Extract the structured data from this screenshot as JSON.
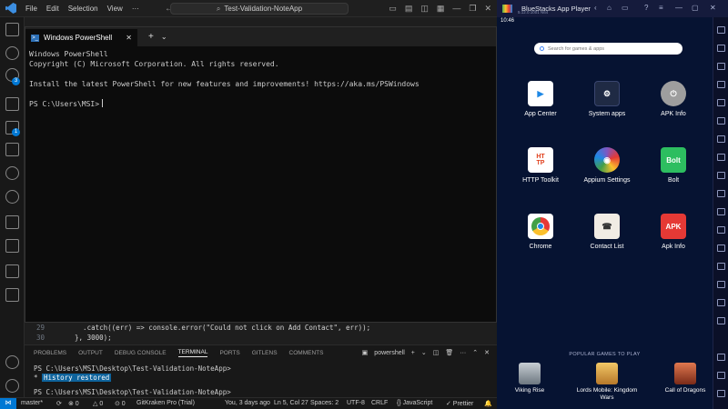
{
  "vscode": {
    "menu": [
      "File",
      "Edit",
      "Selection",
      "View"
    ],
    "more": "···",
    "command_center": "Test-Validation-NoteApp",
    "activity_badges": [
      "3",
      "1"
    ],
    "code": [
      {
        "ln": "29",
        "text": "    .catch((err) => console.error(\"Could not click on Add Contact\", err));"
      },
      {
        "ln": "30",
        "text": "  }, 3000);"
      }
    ],
    "panel": {
      "tabs": [
        "PROBLEMS",
        "OUTPUT",
        "DEBUG CONSOLE",
        "TERMINAL",
        "PORTS",
        "GITLENS",
        "COMMENTS"
      ],
      "active_tab": "TERMINAL",
      "terminal_name": "powershell",
      "lines": [
        "PS C:\\Users\\MSI\\Desktop\\Test-Validation-NoteApp>",
        "History restored",
        "PS C:\\Users\\MSI\\Desktop\\Test-Validation-NoteApp>"
      ]
    },
    "statusbar": {
      "remote": "⋈",
      "branch": "master*",
      "sync": "⟳",
      "errors": "⊗ 0",
      "warnings": "△ 0",
      "ports": "⊙ 0",
      "gitkraken": "GitKraken Pro (Trial)",
      "blame": "You, 3 days ago",
      "position": "Ln 5, Col 27",
      "spaces": "Spaces: 2",
      "encoding": "UTF-8",
      "eol": "CRLF",
      "language": "{} JavaScript",
      "prettier": "✓ Prettier"
    }
  },
  "powershell": {
    "tab_title": "Windows PowerShell",
    "lines": [
      "Windows PowerShell",
      "Copyright (C) Microsoft Corporation. All rights reserved.",
      "",
      "Install the latest PowerShell for new features and improvements! https://aka.ms/PSWindows",
      ""
    ],
    "prompt": "PS C:\\Users\\MSI>"
  },
  "bluestacks": {
    "title": "BlueStacks App Player",
    "version": "5.12.0.1001 N64",
    "time": "10:46",
    "search_placeholder": "Search for games & apps",
    "apps": [
      {
        "label": "App Center",
        "icon": "play-store-icon",
        "bg": "#ffffff",
        "fg": "#1e88e5",
        "glyph": "▶"
      },
      {
        "label": "System apps",
        "icon": "system-apps-icon",
        "bg": "#1f2a44",
        "fg": "#ffffff",
        "glyph": "⚙"
      },
      {
        "label": "APK Info",
        "icon": "apk-info-icon",
        "bg": "#061332",
        "fg": "#cfcfcf",
        "glyph": "⏻"
      },
      {
        "label": "HTTP Toolkit",
        "icon": "http-toolkit-icon",
        "bg": "#ffffff",
        "fg": "#e1421f",
        "glyph": "HT TP"
      },
      {
        "label": "Appium Settings",
        "icon": "appium-icon",
        "bg": "#7e57c2",
        "fg": "#ffffff",
        "glyph": "◉"
      },
      {
        "label": "Bolt",
        "icon": "bolt-icon",
        "bg": "#2dbe60",
        "fg": "#ffffff",
        "glyph": "Bolt"
      },
      {
        "label": "Chrome",
        "icon": "chrome-icon",
        "bg": "#ffffff",
        "fg": "#4285f4",
        "glyph": "◎"
      },
      {
        "label": "Contact List",
        "icon": "contact-list-icon",
        "bg": "#f1ece4",
        "fg": "#333333",
        "glyph": "☎"
      },
      {
        "label": "Apk Info",
        "icon": "apk-info-red-icon",
        "bg": "#e53935",
        "fg": "#ffffff",
        "glyph": "APK"
      }
    ],
    "popular_title": "POPULAR GAMES TO PLAY",
    "games": [
      {
        "label": "Viking Rise",
        "icon": "viking-rise-icon",
        "bg": "#9aa3ad"
      },
      {
        "label": "Lords Mobile: Kingdom Wars",
        "icon": "lords-mobile-icon",
        "bg": "#d9a441"
      },
      {
        "label": "Call of Dragons",
        "icon": "call-of-dragons-icon",
        "bg": "#b34a2e"
      }
    ]
  }
}
